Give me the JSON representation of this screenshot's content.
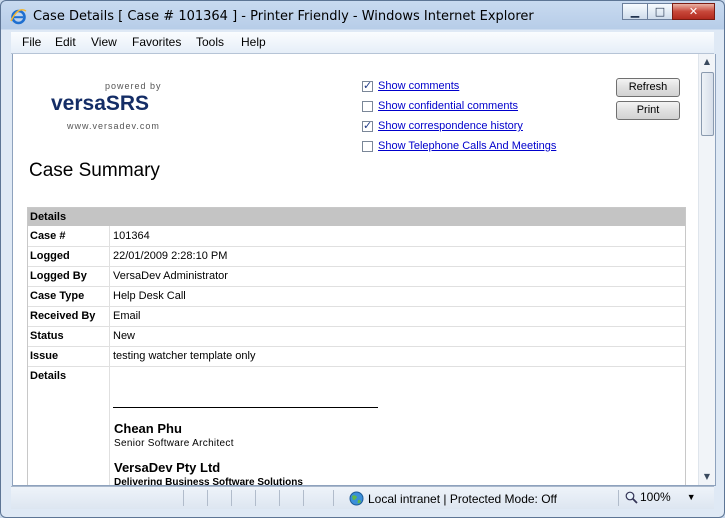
{
  "window": {
    "title": "Case Details [ Case # 101364 ] - Printer Friendly - Windows Internet Explorer",
    "controls": {
      "minimize": "▁",
      "maximize": "□",
      "close": "✕"
    }
  },
  "menu": {
    "items": [
      "File",
      "Edit",
      "View",
      "Favorites",
      "Tools",
      "Help"
    ]
  },
  "logo": {
    "powered_by": "powered by",
    "name": "versaSRS",
    "url": "www.versadev.com"
  },
  "options": [
    {
      "label": "Show comments",
      "checked": true
    },
    {
      "label": "Show confidential comments",
      "checked": false
    },
    {
      "label": "Show correspondence history",
      "checked": true
    },
    {
      "label": "Show Telephone Calls And Meetings",
      "checked": false
    }
  ],
  "buttons": {
    "refresh": "Refresh",
    "print": "Print"
  },
  "page": {
    "heading": "Case Summary"
  },
  "details": {
    "header": "Details",
    "rows": [
      {
        "label": "Case #",
        "value": "101364"
      },
      {
        "label": "Logged",
        "value": "22/01/2009 2:28:10 PM"
      },
      {
        "label": "Logged By",
        "value": "VersaDev Administrator"
      },
      {
        "label": "Case Type",
        "value": "Help Desk Call"
      },
      {
        "label": "Received By",
        "value": "Email"
      },
      {
        "label": "Status",
        "value": "New"
      },
      {
        "label": "Issue",
        "value": "testing watcher template only"
      },
      {
        "label": "Details",
        "value": ""
      }
    ],
    "signature": {
      "name": "Chean Phu",
      "title": "Senior Software Architect",
      "company": "VersaDev Pty Ltd",
      "tagline": "Delivering Business Software Solutions"
    }
  },
  "status_bar": {
    "zone": "Local intranet | Protected Mode: Off",
    "zoom": "100%"
  },
  "colors": {
    "link": "#0000cc",
    "logo": "#142d66",
    "table_header": "#c4c4c4"
  }
}
